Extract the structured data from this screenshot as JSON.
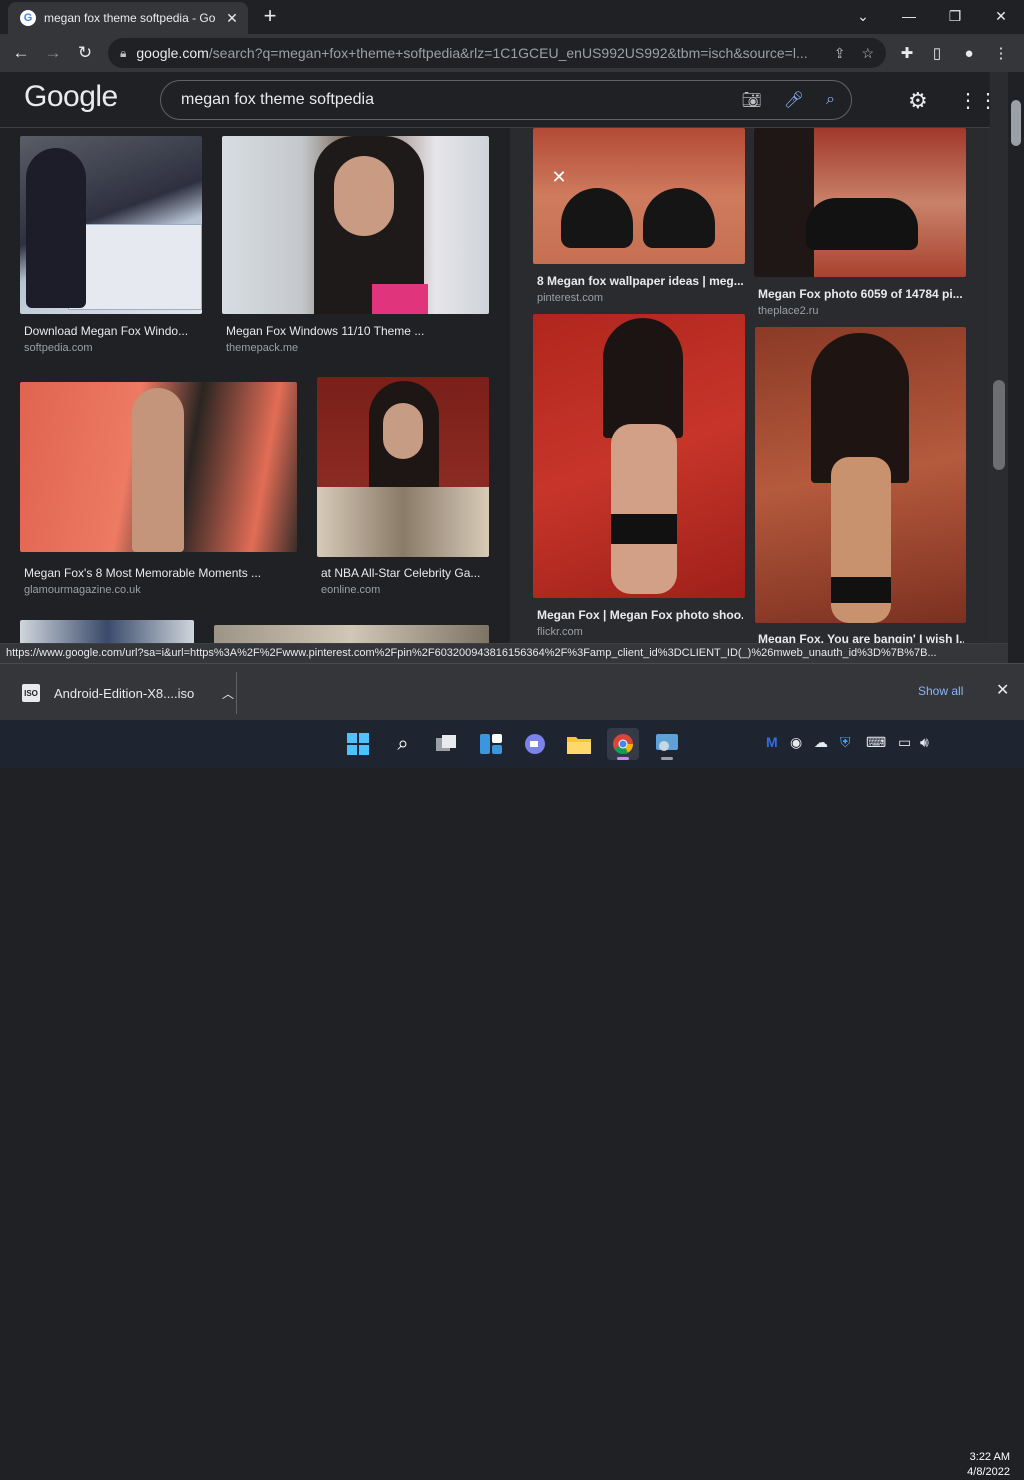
{
  "browser": {
    "tab_title": "megan fox theme softpedia - Go",
    "tab_favicon": "G",
    "url_domain": "google.com",
    "url_rest": "/search?q=megan+fox+theme+softpedia&rlz=1C1GCEU_enUS992US992&tbm=isch&source=l..."
  },
  "google": {
    "logo": "Google",
    "query": "megan fox theme softpedia"
  },
  "results": [
    {
      "caption": "Download Megan Fox Windo...",
      "source": "softpedia.com"
    },
    {
      "caption": "Megan Fox Windows 11/10 Theme ...",
      "source": "themepack.me"
    },
    {
      "caption": "Megan Fox's 8 Most Memorable Moments ...",
      "source": "glamourmagazine.co.uk"
    },
    {
      "caption": "at NBA All-Star Celebrity Ga...",
      "source": "eonline.com"
    }
  ],
  "related": [
    {
      "caption": "8 Megan fox wallpaper ideas | meg...",
      "source": "pinterest.com"
    },
    {
      "caption": "Megan Fox photo 6059 of 14784 pi...",
      "source": "theplace2.ru"
    },
    {
      "caption": "Megan Fox | Megan Fox photo shoo...",
      "source": "flickr.com"
    },
    {
      "caption": "Megan Fox. You are bangin' I wish I..."
    }
  ],
  "status_url": "https://www.google.com/url?sa=i&url=https%3A%2F%2Fwww.pinterest.com%2Fpin%2F603200943816156364%2F%3Famp_client_id%3DCLIENT_ID(_)%26mweb_unauth_id%3D%7B%7B...",
  "downloads": {
    "file_name": "Android-Edition-X8....iso",
    "show_all": "Show all"
  },
  "clock": {
    "time": "3:22 AM",
    "date": "4/8/2022"
  },
  "colors": {
    "accent": "#8ab4f8",
    "background": "#202124"
  }
}
